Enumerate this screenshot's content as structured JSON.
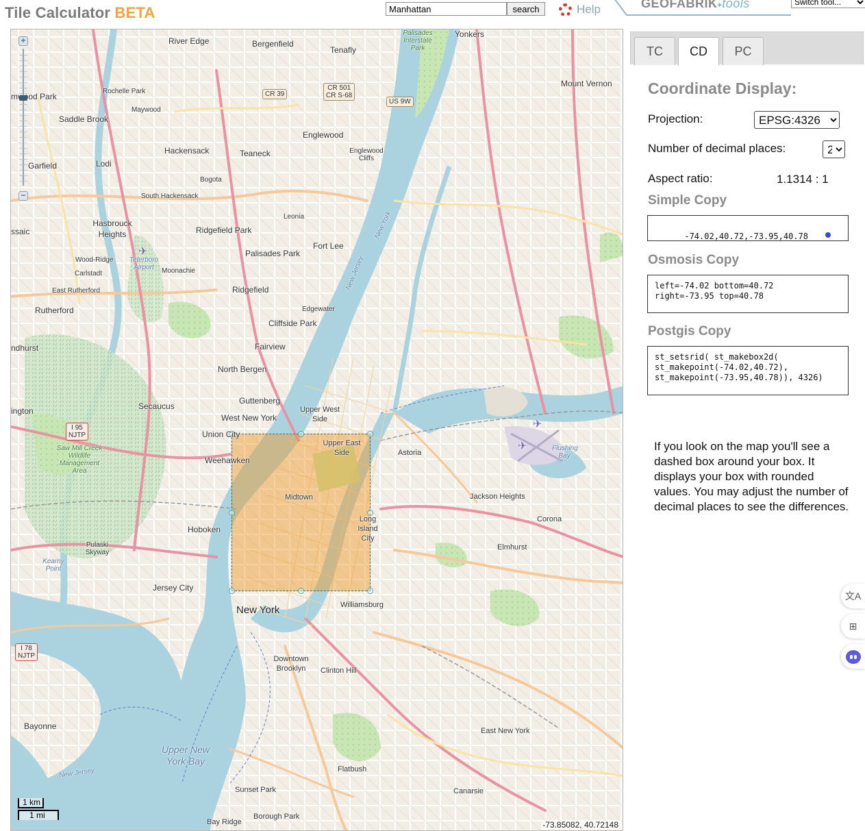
{
  "header": {
    "title": "Tile Calculator",
    "beta": "BETA",
    "search_value": "Manhattan",
    "search_button": "search",
    "help_label": "Help",
    "brand_name": "GEOFABRIK",
    "brand_tools": "tools",
    "switch_tool_value": "Switch tool..."
  },
  "map": {
    "mouse_position": "-73.85082, 40.72148",
    "scale_km": "1 km",
    "scale_mi": "1 mi",
    "selection_fill_color": "#f0962a",
    "labels": {
      "river_edge": "River Edge",
      "bergenfield": "Bergenfield",
      "tenafly": "Tenafly",
      "yonkers": "Yonkers",
      "mount_vernon": "Mount Vernon",
      "rochelle_park": "Rochelle Park",
      "maywood": "Maywood",
      "saddle_brook": "Saddle Brook",
      "englewood": "Englewood",
      "englewood_cliffs": "Englewood Cliffs",
      "hackensack": "Hackensack",
      "teaneck": "Teaneck",
      "garfield": "Garfield",
      "lodi": "Lodi",
      "bogota": "Bogota",
      "south_hackensack": "South Hackensack",
      "leonia": "Leonia",
      "hasbrouck_heights": "Hasbrouck Heights",
      "ridgefield_park": "Ridgefield Park",
      "fort_lee": "Fort Lee",
      "palisades_park": "Palisades Park",
      "wood_ridge": "Wood-Ridge",
      "carlstadt": "Carlstadt",
      "teterboro": "Teterboro Airport",
      "moonachie": "Moonachie",
      "ridgefield": "Ridgefield",
      "east_rutherford": "East Rutherford",
      "rutherford": "Rutherford",
      "edgewater": "Edgewater",
      "cliffside_park": "Cliffside Park",
      "fairview": "Fairview",
      "north_bergen": "North Bergen",
      "guttenberg": "Guttenberg",
      "secaucus": "Secaucus",
      "west_new_york": "West New York",
      "upper_west_side": "Upper West Side",
      "union_city": "Union City",
      "upper_east_side": "Upper East Side",
      "astoria": "Astoria",
      "weehawken": "Weehawken",
      "midtown": "Midtown",
      "jackson_heights": "Jackson Heights",
      "hoboken": "Hoboken",
      "long_island_city": "Long Island City",
      "corona": "Corona",
      "elmhurst": "Elmhurst",
      "pulaski_skyway": "Pulaski Skyway",
      "kearny_point": "Kearny Point",
      "jersey_city": "Jersey City",
      "new_york": "New York",
      "williamsburg": "Williamsburg",
      "downtown_brooklyn": "Downtown Brooklyn",
      "clinton_hill": "Clinton Hill",
      "bayonne": "Bayonne",
      "east_new_york": "East New York",
      "upper_new_york_bay": "Upper New York Bay",
      "flatbush": "Flatbush",
      "sunset_park": "Sunset Park",
      "canarsie": "Canarsie",
      "borough_park": "Borough Park",
      "bay_ridge": "Bay Ridge",
      "flushing_bay": "Flushing Bay",
      "sawmill_creek": "Saw Mill Creek Wildlife Management Area",
      "palisades_park_ny": "Palisades Interstate Park",
      "new_york_river": "New York",
      "new_jersey_river": "New Jersey",
      "new_jersey_bay": "New Jersey",
      "new_york_bay": "New York",
      "lyndhurst": "ndhurst",
      "kington": "ington",
      "ssaic": "ssaic",
      "mwood_park": "mwood Park"
    },
    "shields": {
      "cr39": "CR 39",
      "cr501": "CR 501\nCR S-68",
      "us9w": "US 9W",
      "i95": "I 95\nNJTP",
      "i78": "I 78\nNJTP"
    }
  },
  "panel": {
    "tabs": [
      "TC",
      "CD",
      "PC"
    ],
    "active_tab": "CD",
    "title": "Coordinate Display:",
    "projection_label": "Projection:",
    "projection_value": "EPSG:4326",
    "decimals_label": "Number of decimal places:",
    "decimals_value": "2",
    "aspect_label": "Aspect ratio:",
    "aspect_value": "1.1314 : 1",
    "simple_title": "Simple Copy",
    "simple_value": "-74.02,40.72,-73.95,40.78",
    "osmosis_title": "Osmosis Copy",
    "osmosis_value": "left=-74.02 bottom=40.72\nright=-73.95 top=40.78",
    "postgis_title": "Postgis Copy",
    "postgis_value": "st_setsrid( st_makebox2d(\nst_makepoint(-74.02,40.72),\nst_makepoint(-73.95,40.78)), 4326)",
    "hint": "If you look on the map you'll see a dashed box around your box. It displays your box with rounded values. You may adjust the number of decimal places to see the differences."
  },
  "side_icons": [
    "translate-icon",
    "apps-icon",
    "assistant-icon"
  ]
}
